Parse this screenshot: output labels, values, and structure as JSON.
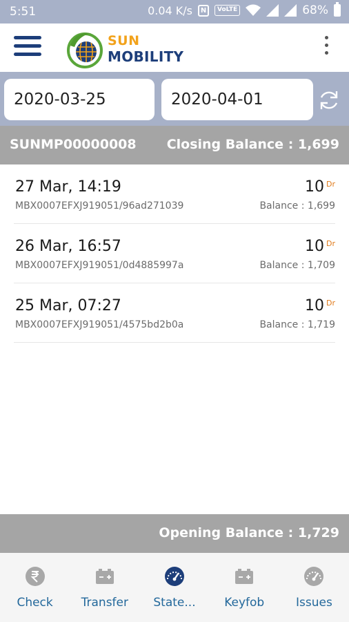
{
  "status_bar": {
    "time": "5:51",
    "speed": "0.04 K/s",
    "nfc": "N",
    "volte": "VoLTE",
    "battery": "68%"
  },
  "app": {
    "logo_top": "SUN",
    "logo_bottom": "MOBILITY"
  },
  "filter": {
    "from_date": "2020-03-25",
    "to_date": "2020-04-01"
  },
  "summary": {
    "account_id": "SUNMP00000008",
    "closing_balance": "Closing Balance : 1,699"
  },
  "transactions": [
    {
      "date": "27 Mar, 14:19",
      "ref": "MBX0007EFXJ919051/96ad271039",
      "amount": "10",
      "type": "Dr",
      "balance": "Balance : 1,699"
    },
    {
      "date": "26 Mar, 16:57",
      "ref": "MBX0007EFXJ919051/0d4885997a",
      "amount": "10",
      "type": "Dr",
      "balance": "Balance : 1,709"
    },
    {
      "date": "25 Mar, 07:27",
      "ref": "MBX0007EFXJ919051/4575bd2b0a",
      "amount": "10",
      "type": "Dr",
      "balance": "Balance : 1,719"
    }
  ],
  "opening_balance": "Opening Balance : 1,729",
  "nav": [
    {
      "label": "Check",
      "icon": "rupee-icon",
      "active": false
    },
    {
      "label": "Transfer",
      "icon": "battery-icon",
      "active": false
    },
    {
      "label": "State...",
      "icon": "speedometer-icon",
      "active": true
    },
    {
      "label": "Keyfob",
      "icon": "battery-icon",
      "active": false
    },
    {
      "label": "Issues",
      "icon": "speedometer-icon",
      "active": false
    }
  ],
  "colors": {
    "header_bar": "#a7b1c8",
    "summary_bar": "#a5a5a5",
    "brand_blue": "#1d3e7a",
    "brand_orange": "#f2a21b",
    "nav_label": "#23689b",
    "debit": "#e07a1a"
  }
}
